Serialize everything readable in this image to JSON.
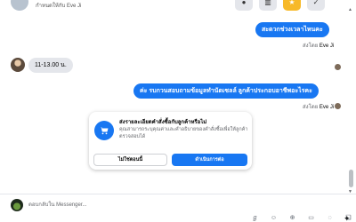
{
  "header": {
    "assigned_text": "กำหนดให้กับ Eve Ji",
    "actions": [
      {
        "icon": "info-icon",
        "glyph": "●"
      },
      {
        "icon": "trash-icon",
        "glyph": "▥"
      },
      {
        "icon": "star-icon",
        "glyph": "★"
      },
      {
        "icon": "check-icon",
        "glyph": "✓"
      }
    ]
  },
  "messages": [
    {
      "text": "สะดวกช่วงเวลาไหนคะ",
      "direction": "outgoing"
    },
    {
      "sent_by_prefix": "ส่งโดย",
      "sent_by_name": "Eve Ji"
    },
    {
      "text": "11-13.00 น.",
      "direction": "incoming"
    },
    {
      "text": "ค่ะ รบกวนสอบถามข้อมูลทำนัดเซลล์ ลูกค้าประกอบอาชีพอะไรคะ",
      "direction": "outgoing"
    },
    {
      "sent_by_prefix": "ส่งโดย",
      "sent_by_name": "Eve Ji"
    }
  ],
  "order_card": {
    "title": "ส่งรายละเอียดคำสั่งซื้อกับลูกค้าหรือไม่",
    "description": "คุณสามารถระบุคุณค่าและคำอธิบายของคำสั่งซื้อเพื่อให้ลูกค้าตรวจสอบได้",
    "secondary_label": "ไม่ใช่ตอนนี้",
    "primary_label": "ดำเนินการต่อ",
    "icon": "cart-icon"
  },
  "composer": {
    "placeholder": "ตอบกลับใน Messenger...",
    "tools": [
      {
        "icon": "gif-icon",
        "glyph": "ℊ"
      },
      {
        "icon": "emoji-icon",
        "glyph": "☺"
      },
      {
        "icon": "attach-icon",
        "glyph": "⊕"
      },
      {
        "icon": "image-icon",
        "glyph": "▭"
      },
      {
        "icon": "sticker-icon",
        "glyph": "◌"
      },
      {
        "icon": "saved-reply-icon",
        "glyph": "❏"
      },
      {
        "icon": "more-icon",
        "glyph": "⋯"
      }
    ],
    "send_glyph": "✦"
  },
  "colors": {
    "accent": "#1877f2",
    "incoming_bubble": "#e4e6eb",
    "star": "#f7b928"
  }
}
